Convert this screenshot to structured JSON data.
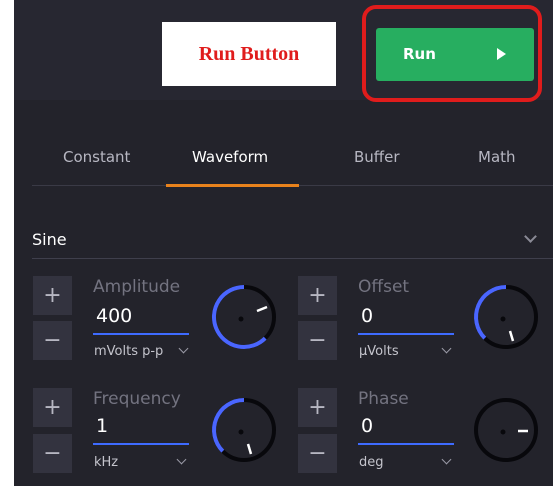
{
  "annotation": {
    "label": "Run Button",
    "color": "#e01c1c"
  },
  "toolbar": {
    "run_label": "Run",
    "run_color": "#27ae60"
  },
  "tabs": [
    {
      "label": "Constant",
      "active": false
    },
    {
      "label": "Waveform",
      "active": true
    },
    {
      "label": "Buffer",
      "active": false
    },
    {
      "label": "Math",
      "active": false
    }
  ],
  "waveform": {
    "selected": "Sine"
  },
  "params": {
    "amplitude": {
      "label": "Amplitude",
      "value": "400",
      "unit": "mVolts p-p"
    },
    "offset": {
      "label": "Offset",
      "value": "0",
      "unit": "µVolts"
    },
    "frequency": {
      "label": "Frequency",
      "value": "1",
      "unit": "kHz"
    },
    "phase": {
      "label": "Phase",
      "value": "0",
      "unit": "deg"
    }
  },
  "controls": {
    "plus": "+",
    "minus": "−"
  },
  "theme": {
    "accent": "#e8821c",
    "knob_arc": "#4a66ff",
    "background": "#23232b"
  }
}
